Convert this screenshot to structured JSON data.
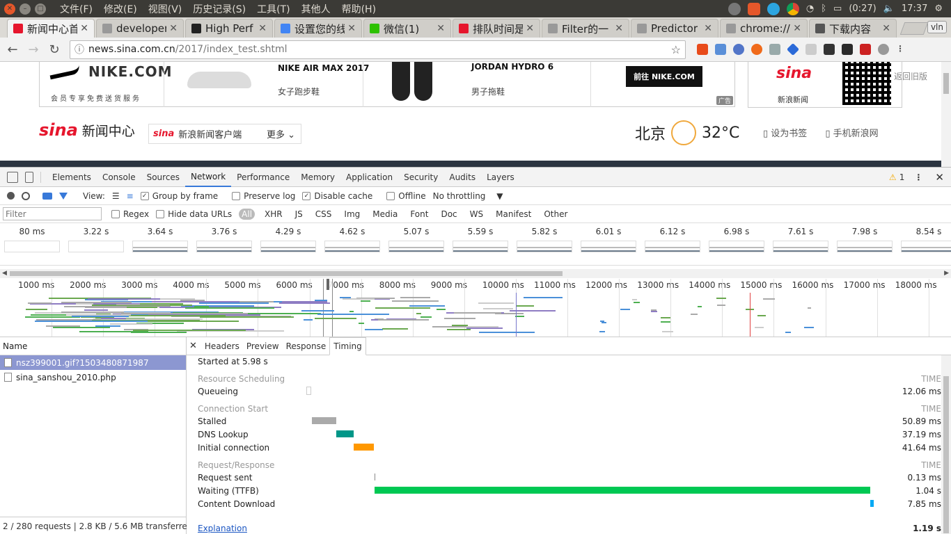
{
  "os": {
    "menus": [
      "文件(F)",
      "修改(E)",
      "视图(V)",
      "历史记录(S)",
      "工具(T)",
      "其他人",
      "帮助(H)"
    ],
    "battery": "(0:27)",
    "clock": "17:37"
  },
  "browser": {
    "tabs": [
      {
        "title": "新闻中心首",
        "color": "#e6162d",
        "active": true
      },
      {
        "title": "developer",
        "color": "#999",
        "active": false
      },
      {
        "title": "High Perf",
        "color": "#222",
        "active": false
      },
      {
        "title": "设置您的线",
        "color": "#4285f4",
        "active": false
      },
      {
        "title": "微信(1)",
        "color": "#2dc100",
        "active": false
      },
      {
        "title": "排队时间是",
        "color": "#e6162d",
        "active": false
      },
      {
        "title": "Filter的一",
        "color": "#999",
        "active": false
      },
      {
        "title": "Predictor",
        "color": "#999",
        "active": false
      },
      {
        "title": "chrome://",
        "color": "#999",
        "active": false
      },
      {
        "title": "下载内容",
        "color": "#555",
        "active": false
      }
    ],
    "profile": "vln",
    "url_host": "news.sina.com.cn",
    "url_path": "/2017/index_test.shtml"
  },
  "page": {
    "ad": {
      "brand": "NIKE.COM",
      "brand_sub": "会员专享免费送货服务",
      "product1_name": "NIKE AIR MAX 2017",
      "product1_desc": "女子跑步鞋",
      "product2_name": "JORDAN HYDRO 6",
      "product2_desc": "男子拖鞋",
      "cta": "前往 NIKE.COM",
      "ad_tag": "广告"
    },
    "qr_label": "新浪新闻",
    "qr_logo": "sina",
    "old_version": "返回旧版",
    "brand": "sina",
    "brand_cn": "新闻中心",
    "client_logo": "sina",
    "client_text": "新浪新闻客户端",
    "client_more": "更多",
    "city": "北京",
    "temp": "32°C",
    "bookmark": "设为书签",
    "mobile": "手机新浪网"
  },
  "devtools": {
    "tabs": [
      "Elements",
      "Console",
      "Sources",
      "Network",
      "Performance",
      "Memory",
      "Application",
      "Security",
      "Audits",
      "Layers"
    ],
    "active_tab": "Network",
    "warnings": "1",
    "toolbar": {
      "view_label": "View:",
      "group_by_frame": "Group by frame",
      "preserve_log": "Preserve log",
      "disable_cache": "Disable cache",
      "offline": "Offline",
      "throttling": "No throttling"
    },
    "filter": {
      "placeholder": "Filter",
      "regex": "Regex",
      "hide_data_urls": "Hide data URLs",
      "types": [
        "All",
        "XHR",
        "JS",
        "CSS",
        "Img",
        "Media",
        "Font",
        "Doc",
        "WS",
        "Manifest",
        "Other"
      ]
    },
    "filmstrip": [
      "80 ms",
      "3.22 s",
      "3.64 s",
      "3.76 s",
      "4.29 s",
      "4.62 s",
      "5.07 s",
      "5.59 s",
      "5.82 s",
      "6.01 s",
      "6.12 s",
      "6.98 s",
      "7.61 s",
      "7.98 s",
      "8.54 s"
    ],
    "overview_ticks": [
      "1000 ms",
      "2000 ms",
      "3000 ms",
      "4000 ms",
      "5000 ms",
      "6000 ms",
      "7000 ms",
      "8000 ms",
      "9000 ms",
      "10000 ms",
      "11000 ms",
      "12000 ms",
      "13000 ms",
      "14000 ms",
      "15000 ms",
      "16000 ms",
      "17000 ms",
      "18000 ms"
    ],
    "requests_header": "Name",
    "requests": [
      {
        "name": "nsz399001.gif?1503480871987",
        "selected": true
      },
      {
        "name": "sina_sanshou_2010.php",
        "selected": false
      }
    ],
    "summary": "2 / 280 requests  |  2.8 KB / 5.6 MB transferre...",
    "detail_tabs": [
      "Headers",
      "Preview",
      "Response",
      "Timing"
    ],
    "active_detail_tab": "Timing",
    "timing": {
      "started": "Started at 5.98 s",
      "time_header": "TIME",
      "sections": [
        {
          "title": "Resource Scheduling",
          "rows": [
            {
              "label": "Queueing",
              "value": "12.06 ms"
            }
          ]
        },
        {
          "title": "Connection Start",
          "rows": [
            {
              "label": "Stalled",
              "value": "50.89 ms"
            },
            {
              "label": "DNS Lookup",
              "value": "37.19 ms"
            },
            {
              "label": "Initial connection",
              "value": "41.64 ms"
            }
          ]
        },
        {
          "title": "Request/Response",
          "rows": [
            {
              "label": "Request sent",
              "value": "0.13 ms"
            },
            {
              "label": "Waiting (TTFB)",
              "value": "1.04 s"
            },
            {
              "label": "Content Download",
              "value": "7.85 ms"
            }
          ]
        }
      ],
      "explanation": "Explanation",
      "total": "1.19 s"
    }
  }
}
